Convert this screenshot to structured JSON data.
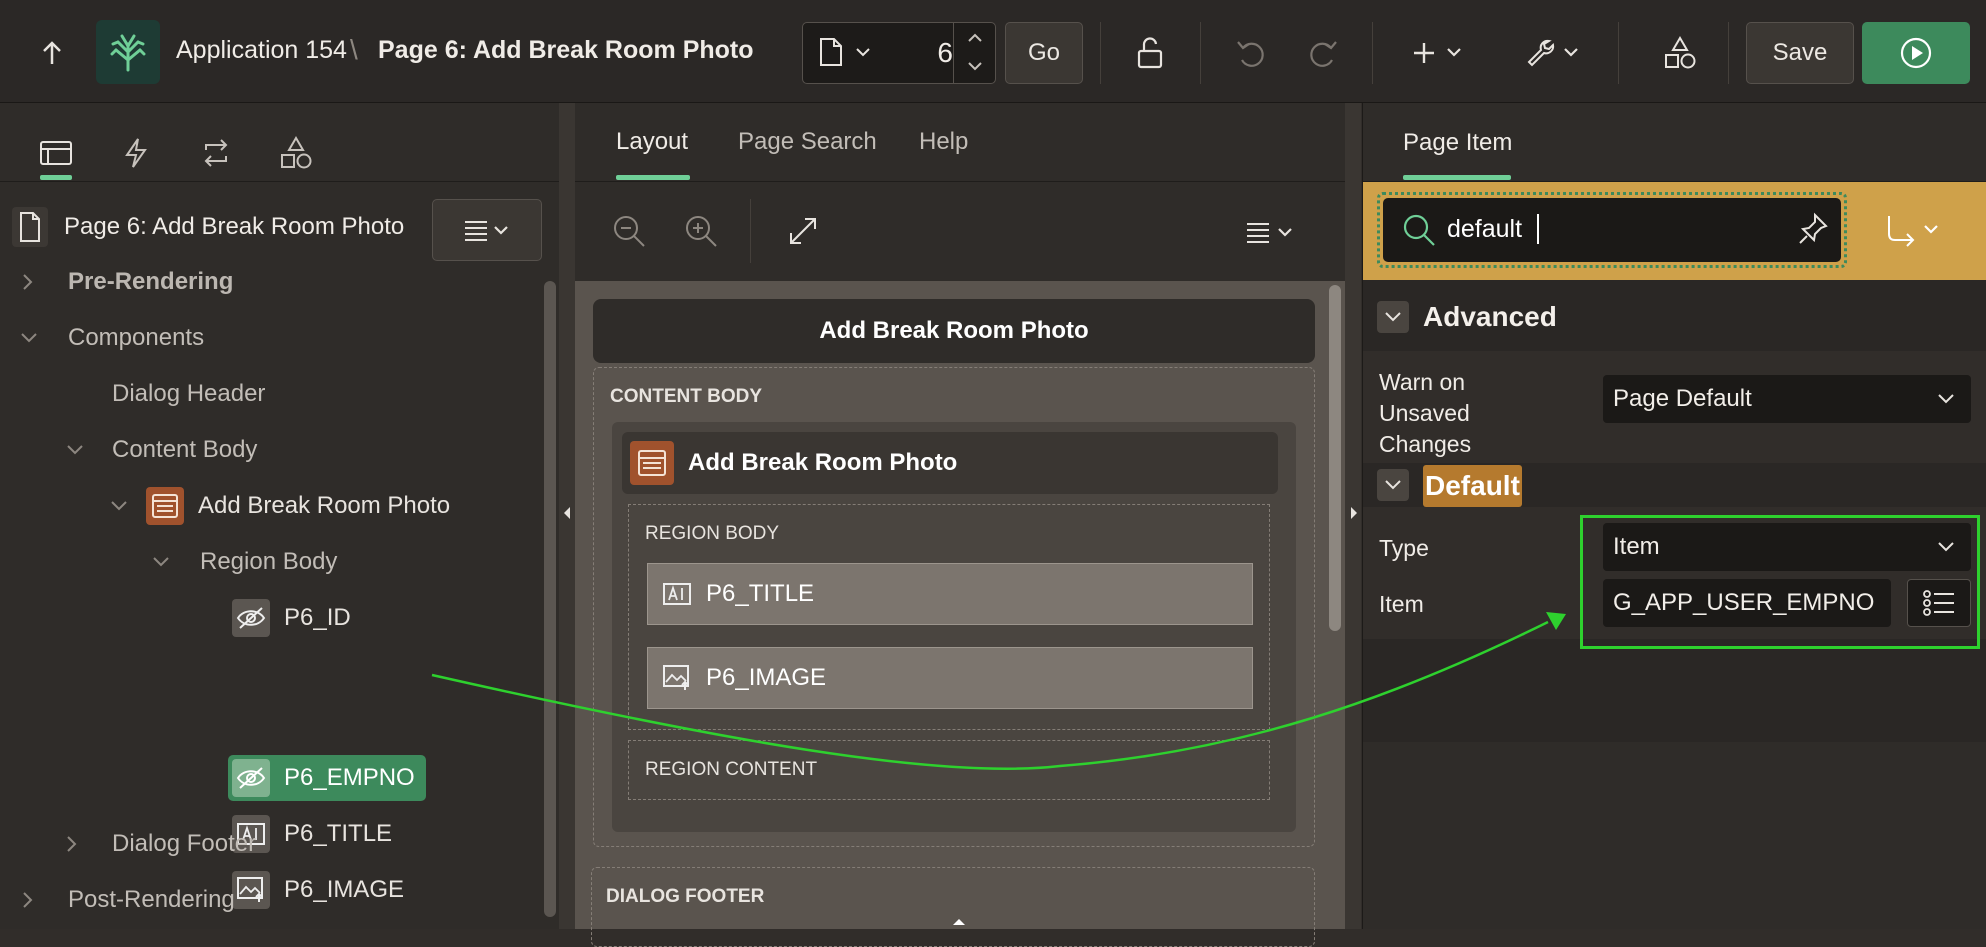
{
  "topbar": {
    "app_name": "Application 154",
    "separator": "\\",
    "page_title": "Page 6: Add Break Room Photo",
    "page_number": "6",
    "go_label": "Go",
    "save_label": "Save"
  },
  "left": {
    "page_label": "Page 6: Add Break Room Photo",
    "tree": {
      "pre_rendering": "Pre-Rendering",
      "components": "Components",
      "dialog_header": "Dialog Header",
      "content_body": "Content Body",
      "region": "Add Break Room Photo",
      "region_body": "Region Body",
      "items": [
        "P6_ID",
        "P6_EMPNO",
        "P6_TITLE",
        "P6_IMAGE"
      ],
      "dialog_footer": "Dialog Footer",
      "post_rendering": "Post-Rendering"
    }
  },
  "middle": {
    "tabs": [
      "Layout",
      "Page Search",
      "Help"
    ],
    "canvas": {
      "dialog_title": "Add Break Room Photo",
      "content_body": "CONTENT BODY",
      "region_title": "Add Break Room Photo",
      "region_body": "REGION BODY",
      "items": [
        "P6_TITLE",
        "P6_IMAGE"
      ],
      "region_content": "REGION CONTENT",
      "dialog_footer": "DIALOG FOOTER"
    }
  },
  "right": {
    "tab": "Page Item",
    "search_value": "default",
    "advanced_heading": "Advanced",
    "warn_label": "Warn on Unsaved Changes",
    "warn_value": "Page Default",
    "default_heading": "Default",
    "type_label": "Type",
    "type_value": "Item",
    "item_label": "Item",
    "item_value": "G_APP_USER_EMPNO"
  },
  "colors": {
    "accent_green": "#3d8a5c",
    "search_band": "#cfa14a",
    "highlight_box": "#2ed12e",
    "region_icon": "#a0522d"
  }
}
